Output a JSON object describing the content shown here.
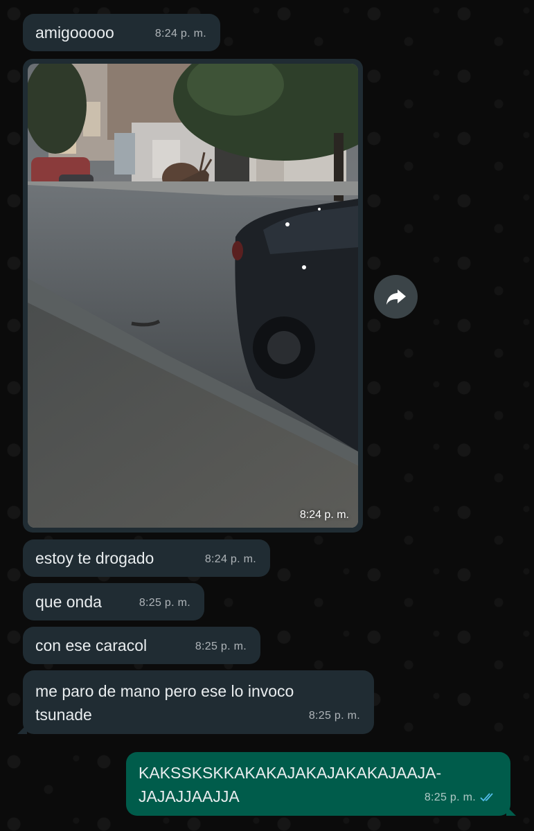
{
  "colors": {
    "incoming_bubble": "#202c33",
    "outgoing_bubble": "#005c4b",
    "read_ticks": "#53bdeb",
    "chat_background": "#0b0b0b"
  },
  "messages": [
    {
      "id": "m1",
      "direction": "incoming",
      "type": "text",
      "text": "amigooooo",
      "time": "8:24 p. m."
    },
    {
      "id": "m2",
      "direction": "incoming",
      "type": "image",
      "time": "8:24 p. m.",
      "icon": "forward-icon"
    },
    {
      "id": "m3",
      "direction": "incoming",
      "type": "text",
      "text": "estoy te drogado",
      "time": "8:24 p. m."
    },
    {
      "id": "m4",
      "direction": "incoming",
      "type": "text",
      "text": "que onda",
      "time": "8:25 p. m."
    },
    {
      "id": "m5",
      "direction": "incoming",
      "type": "text",
      "text": "con ese caracol",
      "time": "8:25 p. m."
    },
    {
      "id": "m6",
      "direction": "incoming",
      "type": "text",
      "text": "me paro de mano pero ese lo invoco\ntsunade",
      "time": "8:25 p. m."
    },
    {
      "id": "m7",
      "direction": "outgoing",
      "type": "text",
      "text": "KAKSSKSKKAKAKAJAKAJAKAKAJAAJA-\nJAJAJJAAJJA",
      "time": "8:25 p. m.",
      "status_icon": "double-check-read-icon"
    }
  ]
}
